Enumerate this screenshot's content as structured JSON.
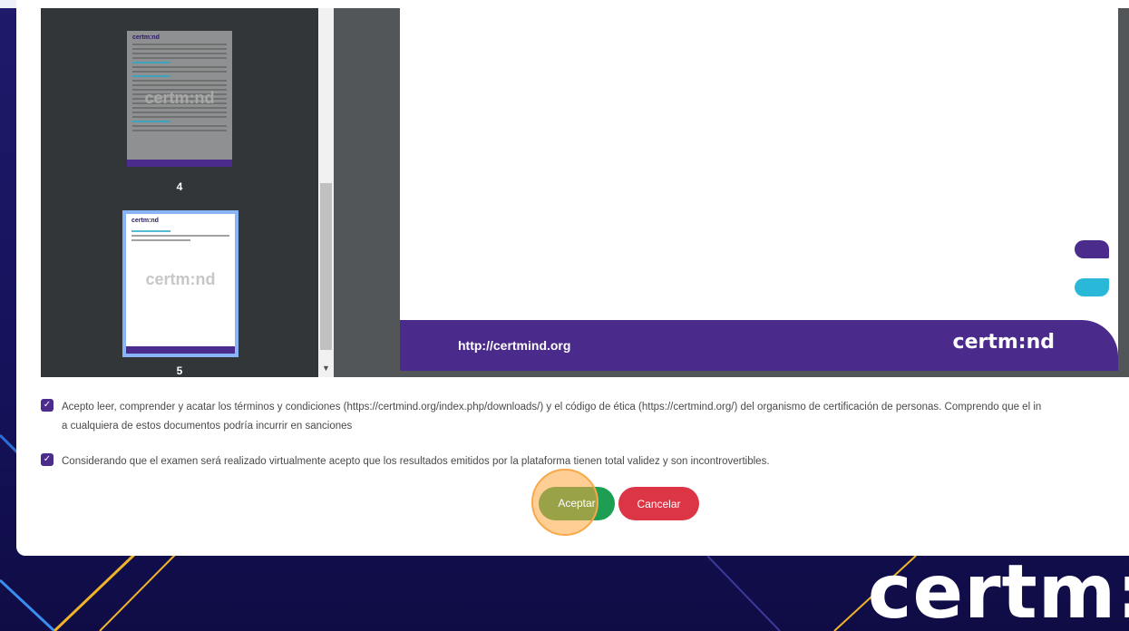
{
  "pdf_viewer": {
    "thumbnails": [
      {
        "page_number": "4",
        "logo": "certm:nd",
        "watermark": "certm:nd"
      },
      {
        "page_number": "5",
        "logo": "certm:nd",
        "watermark": "certm:nd"
      }
    ],
    "page_footer": {
      "url": "http://certmind.org",
      "logo": "certm:nd"
    }
  },
  "terms": {
    "accept_terms_line1": "Acepto leer, comprender y acatar los términos y condiciones (https://certmind.org/index.php/downloads/) y el código de ética (https://certmind.org/) del organismo de certificación de personas. Comprendo que el in",
    "accept_terms_line2": "a cualquiera de estos documentos podría incurrir en sanciones",
    "accept_virtual": "Considerando que el examen será realizado virtualmente acepto que los resultados emitidos por la plataforma tienen total validez y son incontrovertibles."
  },
  "actions": {
    "accept_label": "Aceptar",
    "cancel_label": "Cancelar"
  },
  "background": {
    "brand_text": "certm:"
  },
  "colors": {
    "brand_purple": "#4b2b8c",
    "accent_teal": "#2ab8d8",
    "accept_green": "#1e9e52",
    "cancel_red": "#dc3545",
    "highlight_orange": "#f7a94a"
  }
}
